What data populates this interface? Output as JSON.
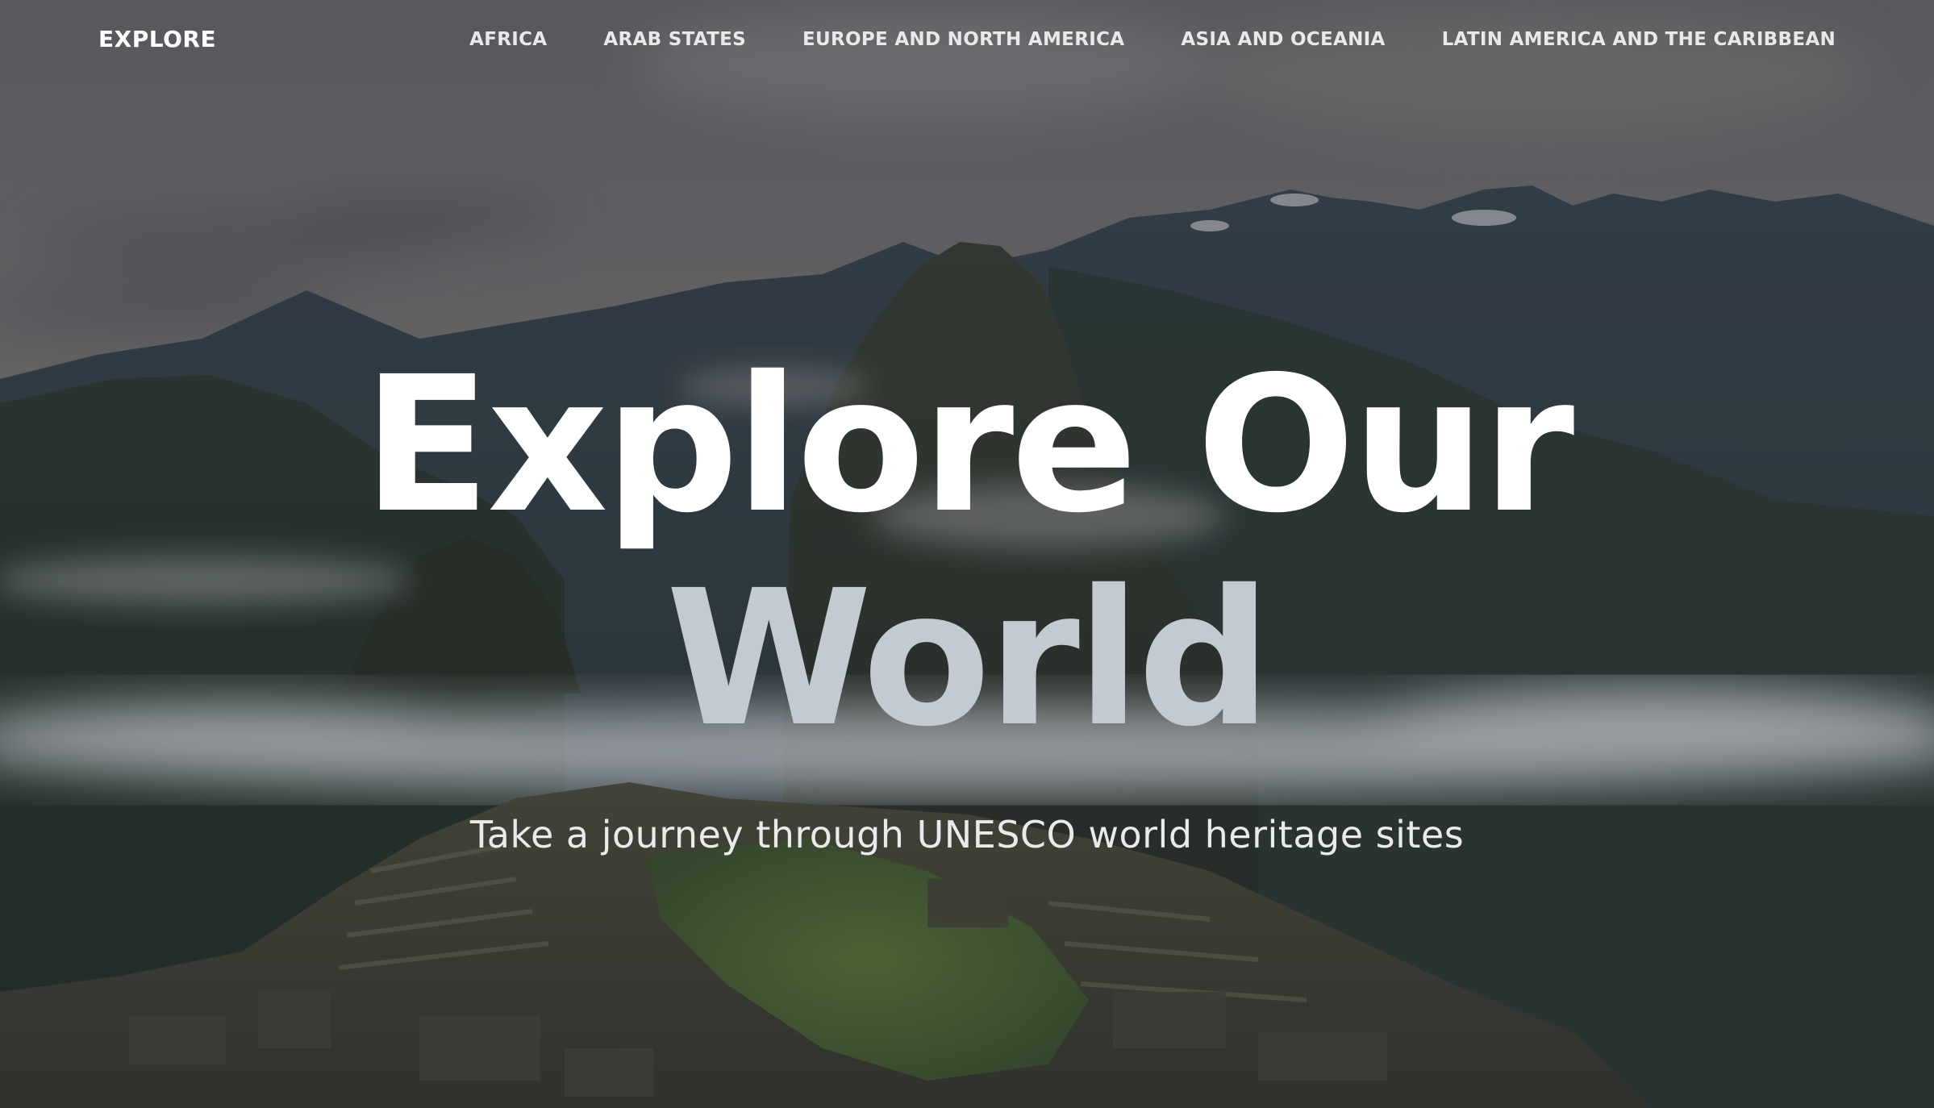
{
  "nav": {
    "logo": "EXPLORE",
    "links": [
      "AFRICA",
      "ARAB STATES",
      "EUROPE AND NORTH AMERICA",
      "ASIA AND OCEANIA",
      "LATIN AMERICA AND THE CARIBBEAN"
    ]
  },
  "hero": {
    "title_line1": "Explore Our",
    "title_line2": "World",
    "subtitle": "Take a journey through UNESCO world heritage sites"
  },
  "colors": {
    "sky": "#7d7c7f",
    "mountain": "#344036",
    "cloud": "#d6dade",
    "grass": "#5c7a3a",
    "title_text": "#ffffff"
  },
  "background": {
    "icon": "mountain-ruins-photo"
  }
}
